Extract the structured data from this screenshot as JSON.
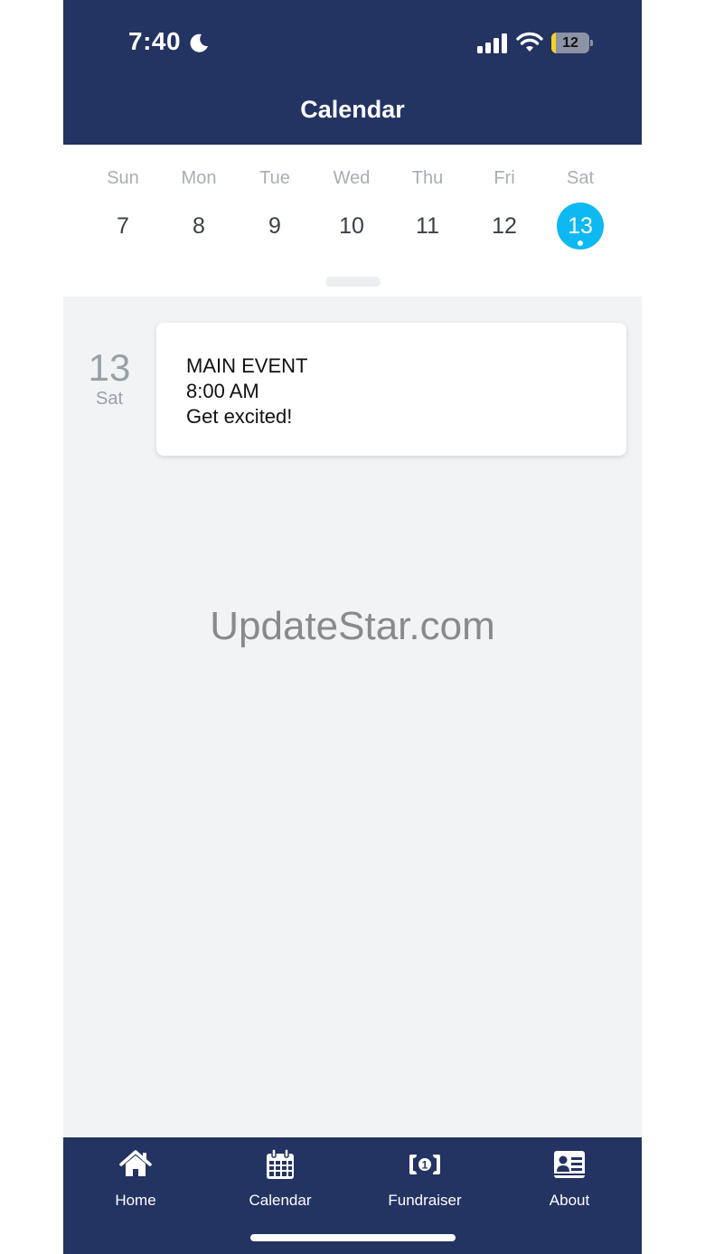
{
  "status_bar": {
    "time": "7:40",
    "battery_level": "12",
    "battery_fraction": 0.12,
    "icons": [
      "moon-icon",
      "cellular-signal-icon",
      "wifi-icon",
      "battery-icon"
    ]
  },
  "header": {
    "title": "Calendar"
  },
  "colors": {
    "header_bg": "#233362",
    "accent": "#0db9f0",
    "agenda_bg": "#f1f3f5"
  },
  "week": {
    "days": [
      {
        "name": "Sun",
        "num": "7"
      },
      {
        "name": "Mon",
        "num": "8"
      },
      {
        "name": "Tue",
        "num": "9"
      },
      {
        "name": "Wed",
        "num": "10"
      },
      {
        "name": "Thu",
        "num": "11"
      },
      {
        "name": "Fri",
        "num": "12"
      },
      {
        "name": "Sat",
        "num": "13",
        "selected": true,
        "has_event": true
      }
    ]
  },
  "agenda": {
    "date_num": "13",
    "date_day": "Sat",
    "event": {
      "title": "MAIN EVENT",
      "time": "8:00 AM",
      "description": "Get excited!"
    },
    "watermark": "UpdateStar.com"
  },
  "tabs": [
    {
      "label": "Home",
      "icon": "home-icon"
    },
    {
      "label": "Calendar",
      "icon": "calendar-icon"
    },
    {
      "label": "Fundraiser",
      "icon": "dollar-bill-icon"
    },
    {
      "label": "About",
      "icon": "contact-card-icon"
    }
  ]
}
